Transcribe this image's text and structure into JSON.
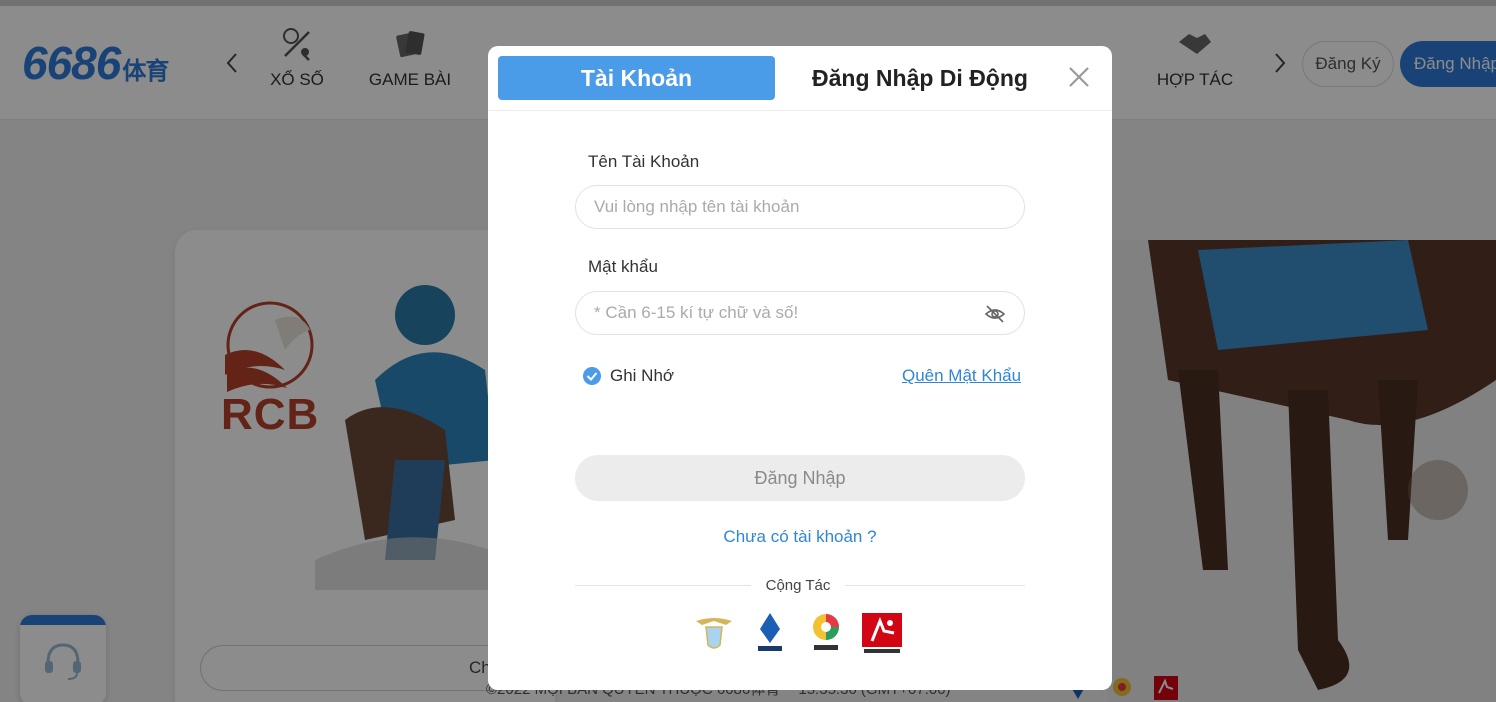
{
  "header": {
    "logo_text": "6686",
    "logo_cn": "体育",
    "nav_items": [
      {
        "label": "XỔ SỐ",
        "icon": "lottery-icon"
      },
      {
        "label": "GAME BÀI",
        "icon": "cards-icon"
      },
      {
        "label": "HỢP TÁC",
        "icon": "handshake-icon"
      }
    ],
    "register_label": "Đăng Ký",
    "login_label": "Đăng Nhập"
  },
  "background": {
    "card_brand": "RCB",
    "card_button_label": "Ch",
    "footer_copyright": "©2022 MỌI BẢN QUYỀN THUỘC 6686体育",
    "footer_time": "15:35:36 (GMT+07:00)"
  },
  "modal": {
    "tab_account": "Tài Khoản",
    "tab_mobile": "Đăng Nhập Di Động",
    "username_label": "Tên Tài Khoản",
    "username_placeholder": "Vui lòng nhập tên tài khoản",
    "username_value": "",
    "password_label": "Mật khẩu",
    "password_placeholder": "* Cần 6-15 kí tự chữ và số!",
    "password_value": "",
    "remember_label": "Ghi Nhớ",
    "remember_checked": true,
    "forgot_label": "Quên Mật Khẩu",
    "submit_label": "Đăng Nhập",
    "no_account_label": "Chưa có tài khoản ?",
    "partners_title": "Cộng Tác",
    "partners": [
      "lazio-logo",
      "serie-a-logo",
      "laliga-logo",
      "bundesliga-logo"
    ]
  },
  "colors": {
    "accent": "#4a9be8",
    "brand_blue": "#2f7ad8",
    "link": "#2f86d8",
    "overlay": "rgba(0,0,0,0.45)"
  }
}
